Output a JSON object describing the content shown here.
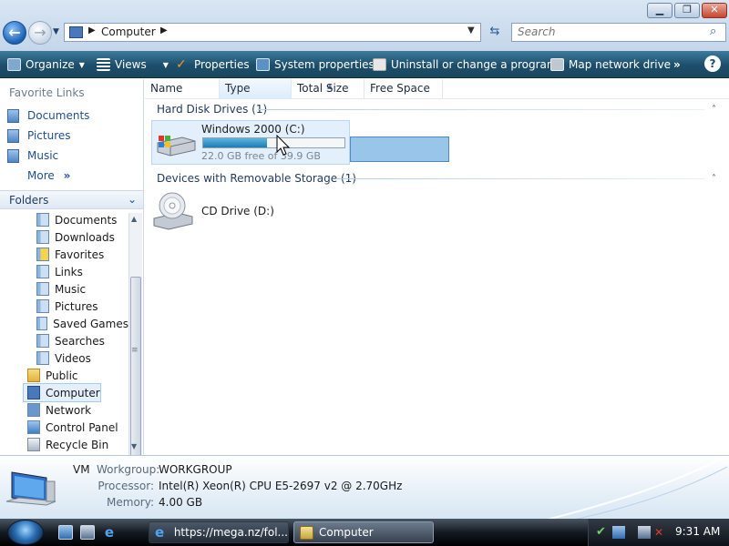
{
  "window": {
    "minimize": "▁",
    "maximize": "❐",
    "close": "✕",
    "back_glyph": "←",
    "forward_glyph": "→"
  },
  "address": {
    "text": "Computer",
    "search_placeholder": "Search"
  },
  "toolbar": {
    "organize": "Organize",
    "views": "Views",
    "properties": "Properties",
    "system_properties": "System properties",
    "uninstall": "Uninstall or change a program",
    "map_network": "Map network drive",
    "overflow": "»"
  },
  "nav": {
    "favorites_header": "Favorite Links",
    "favorites": [
      {
        "label": "Documents"
      },
      {
        "label": "Pictures"
      },
      {
        "label": "Music"
      }
    ],
    "more": "More",
    "more_glyph": "»",
    "folders_header": "Folders",
    "tree": [
      {
        "label": "Documents"
      },
      {
        "label": "Downloads"
      },
      {
        "label": "Favorites"
      },
      {
        "label": "Links"
      },
      {
        "label": "Music"
      },
      {
        "label": "Pictures"
      },
      {
        "label": "Saved Games"
      },
      {
        "label": "Searches"
      },
      {
        "label": "Videos"
      },
      {
        "label": "Public"
      },
      {
        "label": "Computer"
      },
      {
        "label": "Network"
      },
      {
        "label": "Control Panel"
      },
      {
        "label": "Recycle Bin"
      }
    ]
  },
  "columns": {
    "name": "Name",
    "type": "Type",
    "total_size": "Total Size",
    "free_space": "Free Space"
  },
  "groups": {
    "hard_disk": "Hard Disk Drives (1)",
    "removable": "Devices with Removable Storage (1)"
  },
  "drives": {
    "c_name": "Windows 2000 (C:)",
    "c_free_text": "22.0 GB free of 39.9 GB",
    "c_used_fraction": 0.45,
    "d_name": "CD Drive (D:)"
  },
  "details": {
    "name": "VM",
    "workgroup_label": "Workgroup:",
    "workgroup": "WORKGROUP",
    "processor_label": "Processor:",
    "processor": "Intel(R) Xeon(R) CPU E5-2697 v2 @ 2.70GHz",
    "memory_label": "Memory:",
    "memory": "4.00 GB"
  },
  "taskbar": {
    "ie_task": "https://mega.nz/fol...",
    "computer_task": "Computer",
    "clock": "9:31 AM"
  },
  "colors": {
    "toolbar": "#1c4e6a",
    "selection": "#e3effb",
    "link": "#1f4f91",
    "drive_bar": "#1a7db5"
  }
}
